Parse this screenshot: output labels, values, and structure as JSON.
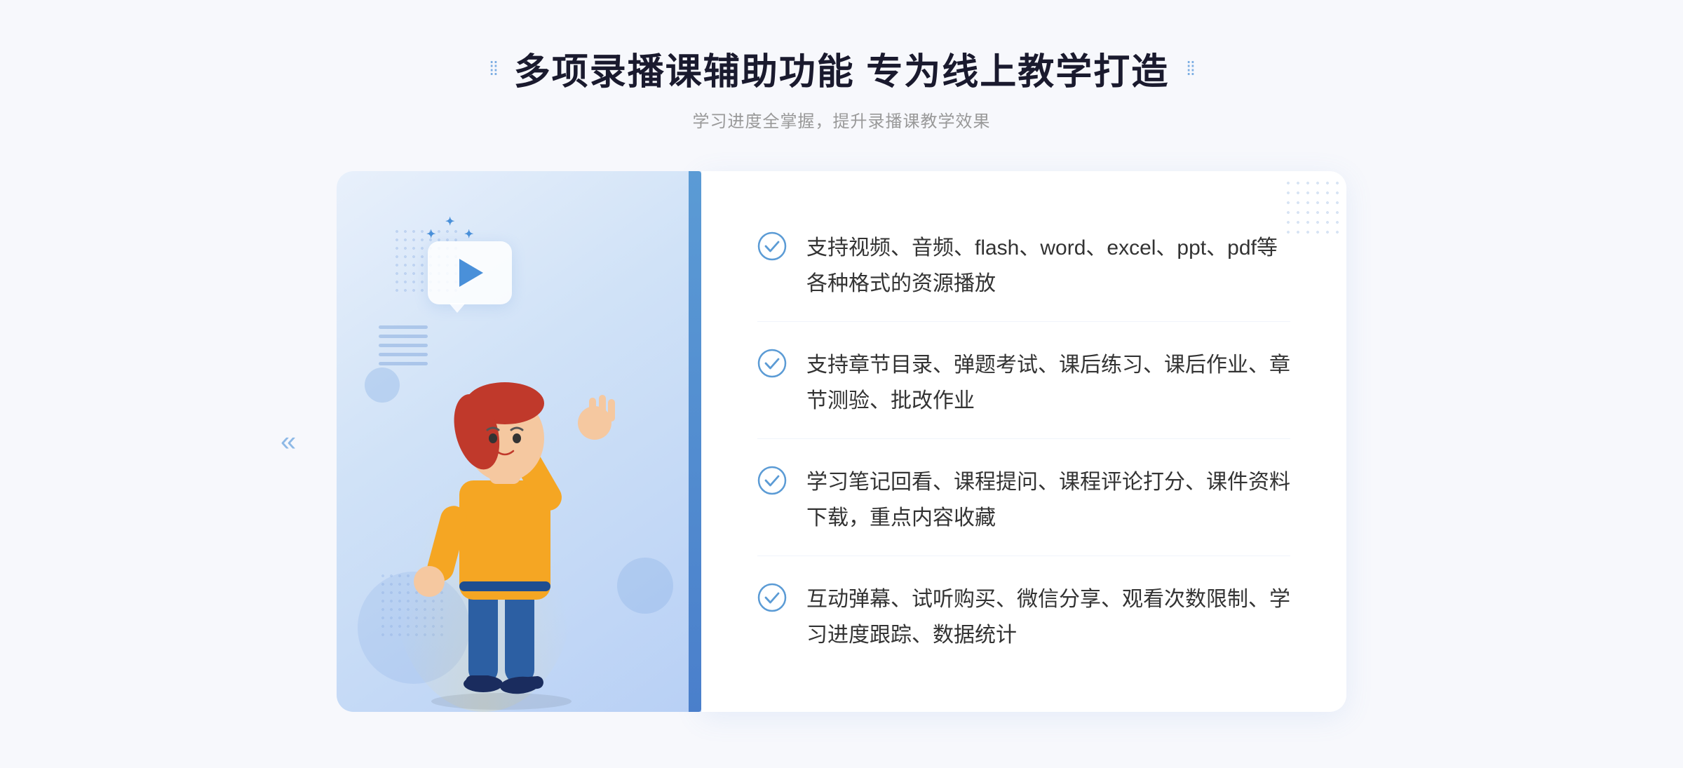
{
  "header": {
    "title": "多项录播课辅助功能 专为线上教学打造",
    "subtitle": "学习进度全掌握，提升录播课教学效果",
    "dots_left": "⁞⁞",
    "dots_right": "⁞⁞"
  },
  "features": [
    {
      "id": 1,
      "text": "支持视频、音频、flash、word、excel、ppt、pdf等各种格式的资源播放"
    },
    {
      "id": 2,
      "text": "支持章节目录、弹题考试、课后练习、课后作业、章节测验、批改作业"
    },
    {
      "id": 3,
      "text": "学习笔记回看、课程提问、课程评论打分、课件资料下载，重点内容收藏"
    },
    {
      "id": 4,
      "text": "互动弹幕、试听购买、微信分享、观看次数限制、学习进度跟踪、数据统计"
    }
  ],
  "colors": {
    "accent": "#4a90d9",
    "title": "#1a1a2e",
    "text": "#333333",
    "subtitle": "#999999",
    "check": "#5b9bd5",
    "bg": "#f7f8fc",
    "panel_bg": "#ffffff"
  },
  "left_chevron": "«",
  "illustration_alt": "Online learning illustration"
}
